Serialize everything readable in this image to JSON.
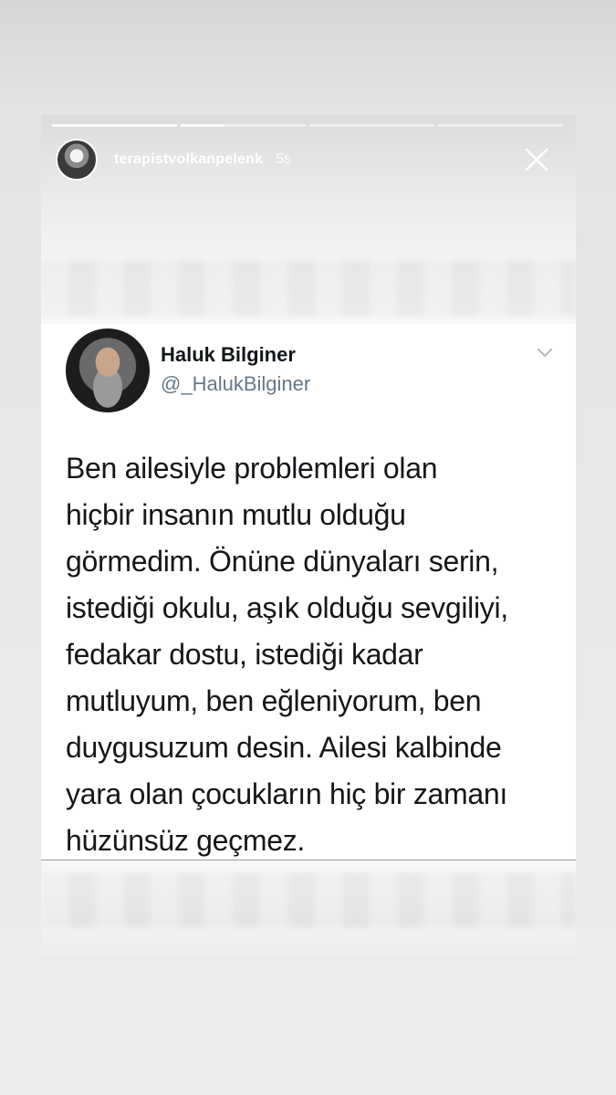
{
  "story": {
    "username": "terapistvolkanpelenk",
    "time": "5s",
    "progress": [
      1,
      0.35,
      0,
      0,
      0
    ]
  },
  "icons": {
    "close": "close-icon",
    "chevron": "chevron-down-icon"
  },
  "tweet": {
    "name": "Haluk Bilginer",
    "handle": "@_HalukBilginer",
    "lines": [
      "Ben ailesiyle problemleri olan",
      "hiçbir insanın mutlu olduğu",
      "görmedim. Önüne dünyaları serin,",
      "istediği okulu, aşık olduğu sevgiliyi,",
      "fedakar dostu, istediği kadar",
      "mutluyum, ben eğleniyorum, ben",
      "duygusuzum desin. Ailesi kalbinde",
      "yara olan çocukların hiç bir zamanı",
      "hüzünsüz geçmez."
    ]
  }
}
